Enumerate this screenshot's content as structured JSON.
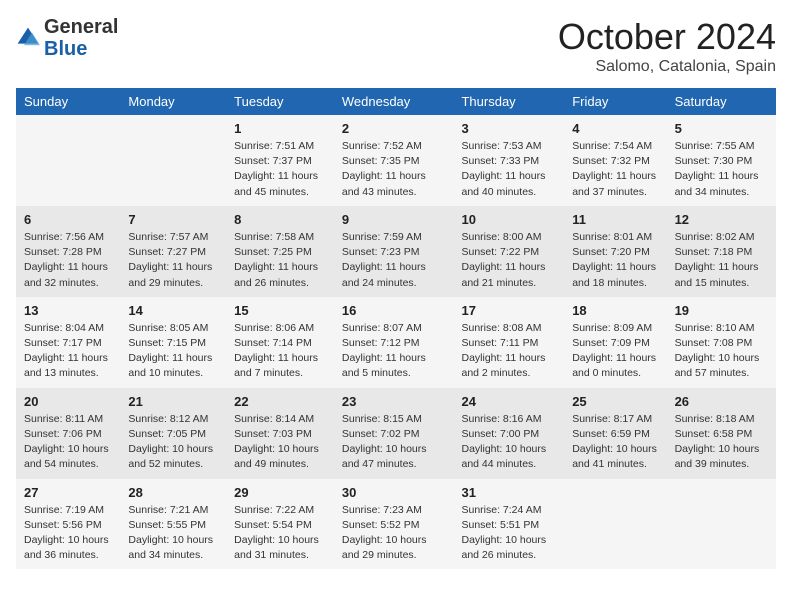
{
  "header": {
    "logo": {
      "general": "General",
      "blue": "Blue"
    },
    "title": "October 2024",
    "subtitle": "Salomo, Catalonia, Spain"
  },
  "weekdays": [
    "Sunday",
    "Monday",
    "Tuesday",
    "Wednesday",
    "Thursday",
    "Friday",
    "Saturday"
  ],
  "weeks": [
    [
      {
        "day": "",
        "info": ""
      },
      {
        "day": "",
        "info": ""
      },
      {
        "day": "1",
        "info": "Sunrise: 7:51 AM\nSunset: 7:37 PM\nDaylight: 11 hours and 45 minutes."
      },
      {
        "day": "2",
        "info": "Sunrise: 7:52 AM\nSunset: 7:35 PM\nDaylight: 11 hours and 43 minutes."
      },
      {
        "day": "3",
        "info": "Sunrise: 7:53 AM\nSunset: 7:33 PM\nDaylight: 11 hours and 40 minutes."
      },
      {
        "day": "4",
        "info": "Sunrise: 7:54 AM\nSunset: 7:32 PM\nDaylight: 11 hours and 37 minutes."
      },
      {
        "day": "5",
        "info": "Sunrise: 7:55 AM\nSunset: 7:30 PM\nDaylight: 11 hours and 34 minutes."
      }
    ],
    [
      {
        "day": "6",
        "info": "Sunrise: 7:56 AM\nSunset: 7:28 PM\nDaylight: 11 hours and 32 minutes."
      },
      {
        "day": "7",
        "info": "Sunrise: 7:57 AM\nSunset: 7:27 PM\nDaylight: 11 hours and 29 minutes."
      },
      {
        "day": "8",
        "info": "Sunrise: 7:58 AM\nSunset: 7:25 PM\nDaylight: 11 hours and 26 minutes."
      },
      {
        "day": "9",
        "info": "Sunrise: 7:59 AM\nSunset: 7:23 PM\nDaylight: 11 hours and 24 minutes."
      },
      {
        "day": "10",
        "info": "Sunrise: 8:00 AM\nSunset: 7:22 PM\nDaylight: 11 hours and 21 minutes."
      },
      {
        "day": "11",
        "info": "Sunrise: 8:01 AM\nSunset: 7:20 PM\nDaylight: 11 hours and 18 minutes."
      },
      {
        "day": "12",
        "info": "Sunrise: 8:02 AM\nSunset: 7:18 PM\nDaylight: 11 hours and 15 minutes."
      }
    ],
    [
      {
        "day": "13",
        "info": "Sunrise: 8:04 AM\nSunset: 7:17 PM\nDaylight: 11 hours and 13 minutes."
      },
      {
        "day": "14",
        "info": "Sunrise: 8:05 AM\nSunset: 7:15 PM\nDaylight: 11 hours and 10 minutes."
      },
      {
        "day": "15",
        "info": "Sunrise: 8:06 AM\nSunset: 7:14 PM\nDaylight: 11 hours and 7 minutes."
      },
      {
        "day": "16",
        "info": "Sunrise: 8:07 AM\nSunset: 7:12 PM\nDaylight: 11 hours and 5 minutes."
      },
      {
        "day": "17",
        "info": "Sunrise: 8:08 AM\nSunset: 7:11 PM\nDaylight: 11 hours and 2 minutes."
      },
      {
        "day": "18",
        "info": "Sunrise: 8:09 AM\nSunset: 7:09 PM\nDaylight: 11 hours and 0 minutes."
      },
      {
        "day": "19",
        "info": "Sunrise: 8:10 AM\nSunset: 7:08 PM\nDaylight: 10 hours and 57 minutes."
      }
    ],
    [
      {
        "day": "20",
        "info": "Sunrise: 8:11 AM\nSunset: 7:06 PM\nDaylight: 10 hours and 54 minutes."
      },
      {
        "day": "21",
        "info": "Sunrise: 8:12 AM\nSunset: 7:05 PM\nDaylight: 10 hours and 52 minutes."
      },
      {
        "day": "22",
        "info": "Sunrise: 8:14 AM\nSunset: 7:03 PM\nDaylight: 10 hours and 49 minutes."
      },
      {
        "day": "23",
        "info": "Sunrise: 8:15 AM\nSunset: 7:02 PM\nDaylight: 10 hours and 47 minutes."
      },
      {
        "day": "24",
        "info": "Sunrise: 8:16 AM\nSunset: 7:00 PM\nDaylight: 10 hours and 44 minutes."
      },
      {
        "day": "25",
        "info": "Sunrise: 8:17 AM\nSunset: 6:59 PM\nDaylight: 10 hours and 41 minutes."
      },
      {
        "day": "26",
        "info": "Sunrise: 8:18 AM\nSunset: 6:58 PM\nDaylight: 10 hours and 39 minutes."
      }
    ],
    [
      {
        "day": "27",
        "info": "Sunrise: 7:19 AM\nSunset: 5:56 PM\nDaylight: 10 hours and 36 minutes."
      },
      {
        "day": "28",
        "info": "Sunrise: 7:21 AM\nSunset: 5:55 PM\nDaylight: 10 hours and 34 minutes."
      },
      {
        "day": "29",
        "info": "Sunrise: 7:22 AM\nSunset: 5:54 PM\nDaylight: 10 hours and 31 minutes."
      },
      {
        "day": "30",
        "info": "Sunrise: 7:23 AM\nSunset: 5:52 PM\nDaylight: 10 hours and 29 minutes."
      },
      {
        "day": "31",
        "info": "Sunrise: 7:24 AM\nSunset: 5:51 PM\nDaylight: 10 hours and 26 minutes."
      },
      {
        "day": "",
        "info": ""
      },
      {
        "day": "",
        "info": ""
      }
    ]
  ]
}
